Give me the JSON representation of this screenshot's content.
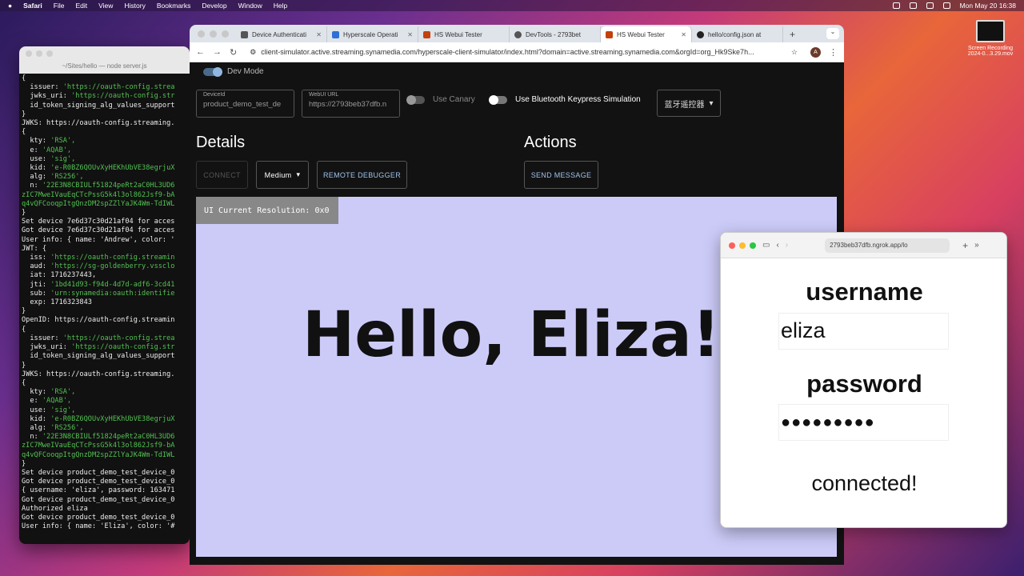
{
  "menubar": {
    "apple": "",
    "app_name": "Safari",
    "items": [
      "File",
      "Edit",
      "View",
      "History",
      "Bookmarks",
      "Develop",
      "Window",
      "Help"
    ],
    "clock": "Mon May 20  16:38"
  },
  "desktop": {
    "recording_label_1": "Screen Recording",
    "recording_label_2": "2024-0...3.29.mov"
  },
  "terminal": {
    "title": "~/Sites/hello — node server.js",
    "lines": [
      "{",
      "  issuer: 'https://oauth-config.strea",
      "  jwks_uri: 'https://oauth-config.str",
      "  id_token_signing_alg_values_support",
      "}",
      "JWKS: https://oauth-config.streaming.",
      "{",
      "  kty: 'RSA',",
      "  e: 'AQAB',",
      "  use: 'sig',",
      "  kid: 'e-R0BZ6QOUvXyHEKhUbVE38egrjuX",
      "  alg: 'RS256',",
      "  n: '22E3N8CBIULf51824peRt2aC0HL3UD6",
      "zIC7MweIVauEqCTcPssG5k4l3ol862Jsf9-bA",
      "q4vQFCooqpItgQnzDM2spZZlYaJK4Wm-TdIWL",
      "}",
      "Set device 7e6d37c30d21af04 for acces",
      "Got device 7e6d37c30d21af04 for acces",
      "User info: { name: 'Andrew', color: '",
      "JWT: {",
      "  iss: 'https://oauth-config.streamin",
      "  aud: 'https://sg-goldenberry.vssclo",
      "  iat: 1716237443,",
      "  jti: '1bd41d93-f94d-4d7d-adf6-3cd41",
      "  sub: 'urn:synamedia:oauth:identifie",
      "  exp: 1716323843",
      "}",
      "OpenID: https://oauth-config.streamin",
      "{",
      "  issuer: 'https://oauth-config.strea",
      "  jwks_uri: 'https://oauth-config.str",
      "  id_token_signing_alg_values_support",
      "}",
      "JWKS: https://oauth-config.streaming.",
      "{",
      "  kty: 'RSA',",
      "  e: 'AQAB',",
      "  use: 'sig',",
      "  kid: 'e-R0BZ6QOUvXyHEKhUbVE38egrjuX",
      "  alg: 'RS256',",
      "  n: '22E3N8CBIULf51824peRt2aC0HL3UD6",
      "zIC7MweIVauEqCTcPssG5k4l3ol862Jsf9-bA",
      "q4vQFCooqpItgQnzDM2spZZlYaJK4Wm-TdIWL",
      "}",
      "Set device product_demo_test_device_0",
      "Got device product_demo_test_device_0",
      "{ username: 'eliza', password: 163471",
      "Got device product_demo_test_device_0",
      "Authorized eliza",
      "Got device product_demo_test_device_0",
      "User info: { name: 'Eliza', color: '#",
      ""
    ]
  },
  "browser": {
    "tabs": [
      {
        "label": "Device Authenticati",
        "active": false
      },
      {
        "label": "Hyperscale Operati",
        "active": false
      },
      {
        "label": "HS Webui Tester",
        "active": false
      },
      {
        "label": "DevTools - 2793bet",
        "active": false
      },
      {
        "label": "HS Webui Tester",
        "active": true
      },
      {
        "label": "hello/config.json at",
        "active": false
      }
    ],
    "url": "client-simulator.active.streaming.synamedia.com/hyperscale-client-simulator/index.html?domain=active.streaming.synamedia.com&orgId=org_Hk9Ske7h...",
    "avatar_letter": "A"
  },
  "page": {
    "dev_mode_label": "Dev Mode",
    "device_id": {
      "label": "DeviceId",
      "value": "product_demo_test_de"
    },
    "webui_url": {
      "label": "WebUI URL",
      "value": "https://2793beb37dfb.n"
    },
    "use_canary_label": "Use Canary",
    "bluetooth_label": "Use Bluetooth Keypress Simulation",
    "remote_select": "蓝牙遥控器",
    "details_heading": "Details",
    "actions_heading": "Actions",
    "connect_button": "CONNECT",
    "quality_select": "Medium",
    "remote_debugger_button": "REMOTE DEBUGGER",
    "send_message_button": "SEND MESSAGE",
    "resolution_text": "UI Current Resolution: 0x0",
    "hello_text": "Hello, Eliza!"
  },
  "mini_window": {
    "url": "2793beb37dfb.ngrok.app/lo",
    "username_label": "username",
    "username_value": "eliza",
    "password_label": "password",
    "password_mask": "●●●●●●●●●",
    "status": "connected!"
  }
}
